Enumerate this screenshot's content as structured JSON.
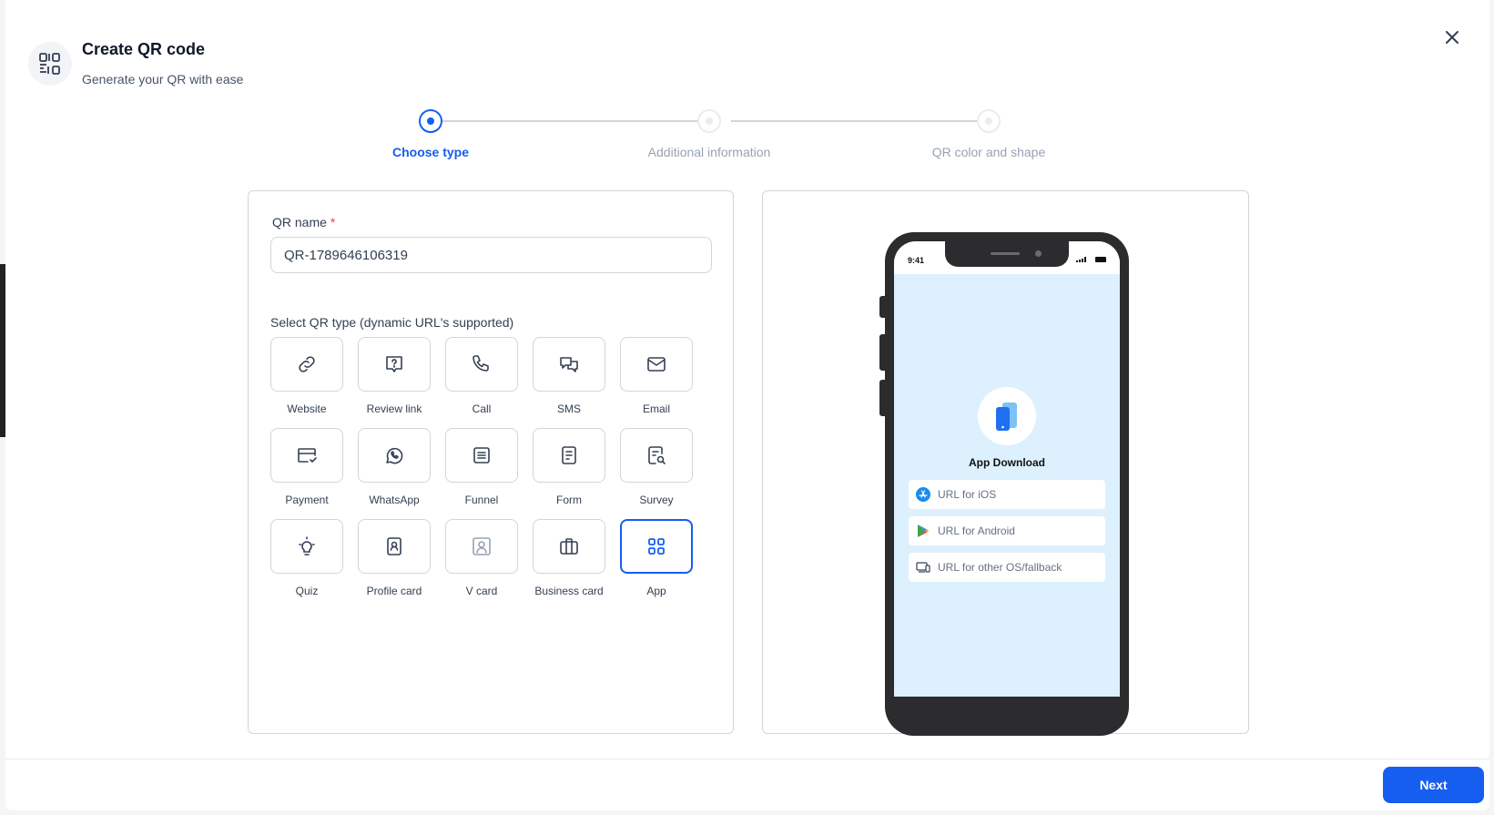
{
  "modal": {
    "title": "Create QR code",
    "subtitle": "Generate your QR with ease",
    "header_icon": "qr-code-icon",
    "close_icon": "close-icon"
  },
  "stepper": {
    "steps": [
      {
        "label": "Choose type",
        "state": "active"
      },
      {
        "label": "Additional information",
        "state": "upcoming"
      },
      {
        "label": "QR color and shape",
        "state": "upcoming"
      }
    ]
  },
  "form": {
    "qr_name_label": "QR name",
    "required_mark": "*",
    "qr_name_value": "QR-1789646106319",
    "type_section_label": "Select QR type (dynamic URL's supported)",
    "types": [
      {
        "label": "Website",
        "icon": "link-icon"
      },
      {
        "label": "Review link",
        "icon": "review-icon"
      },
      {
        "label": "Call",
        "icon": "phone-icon"
      },
      {
        "label": "SMS",
        "icon": "chat-icon"
      },
      {
        "label": "Email",
        "icon": "mail-icon"
      },
      {
        "label": "Payment",
        "icon": "payment-card-icon"
      },
      {
        "label": "WhatsApp",
        "icon": "whatsapp-icon"
      },
      {
        "label": "Funnel",
        "icon": "funnel-icon"
      },
      {
        "label": "Form",
        "icon": "form-icon"
      },
      {
        "label": "Survey",
        "icon": "survey-icon"
      },
      {
        "label": "Quiz",
        "icon": "lightbulb-icon"
      },
      {
        "label": "Profile card",
        "icon": "profile-card-icon"
      },
      {
        "label": "V card",
        "icon": "vcard-icon"
      },
      {
        "label": "Business card",
        "icon": "briefcase-icon"
      },
      {
        "label": "App",
        "icon": "grid-icon",
        "selected": true
      }
    ]
  },
  "preview": {
    "time": "9:41",
    "app_title": "App Download",
    "urls": [
      {
        "label": "URL for iOS",
        "icon": "app-store-icon"
      },
      {
        "label": "URL for Android",
        "icon": "play-store-icon"
      },
      {
        "label": "URL for other OS/fallback",
        "icon": "devices-icon"
      }
    ]
  },
  "footer": {
    "next_label": "Next"
  },
  "colors": {
    "primary": "#155eef",
    "border": "#d0d5dd",
    "preview_bg": "#ddf0fd",
    "phone_frame": "#2c2c2e"
  }
}
